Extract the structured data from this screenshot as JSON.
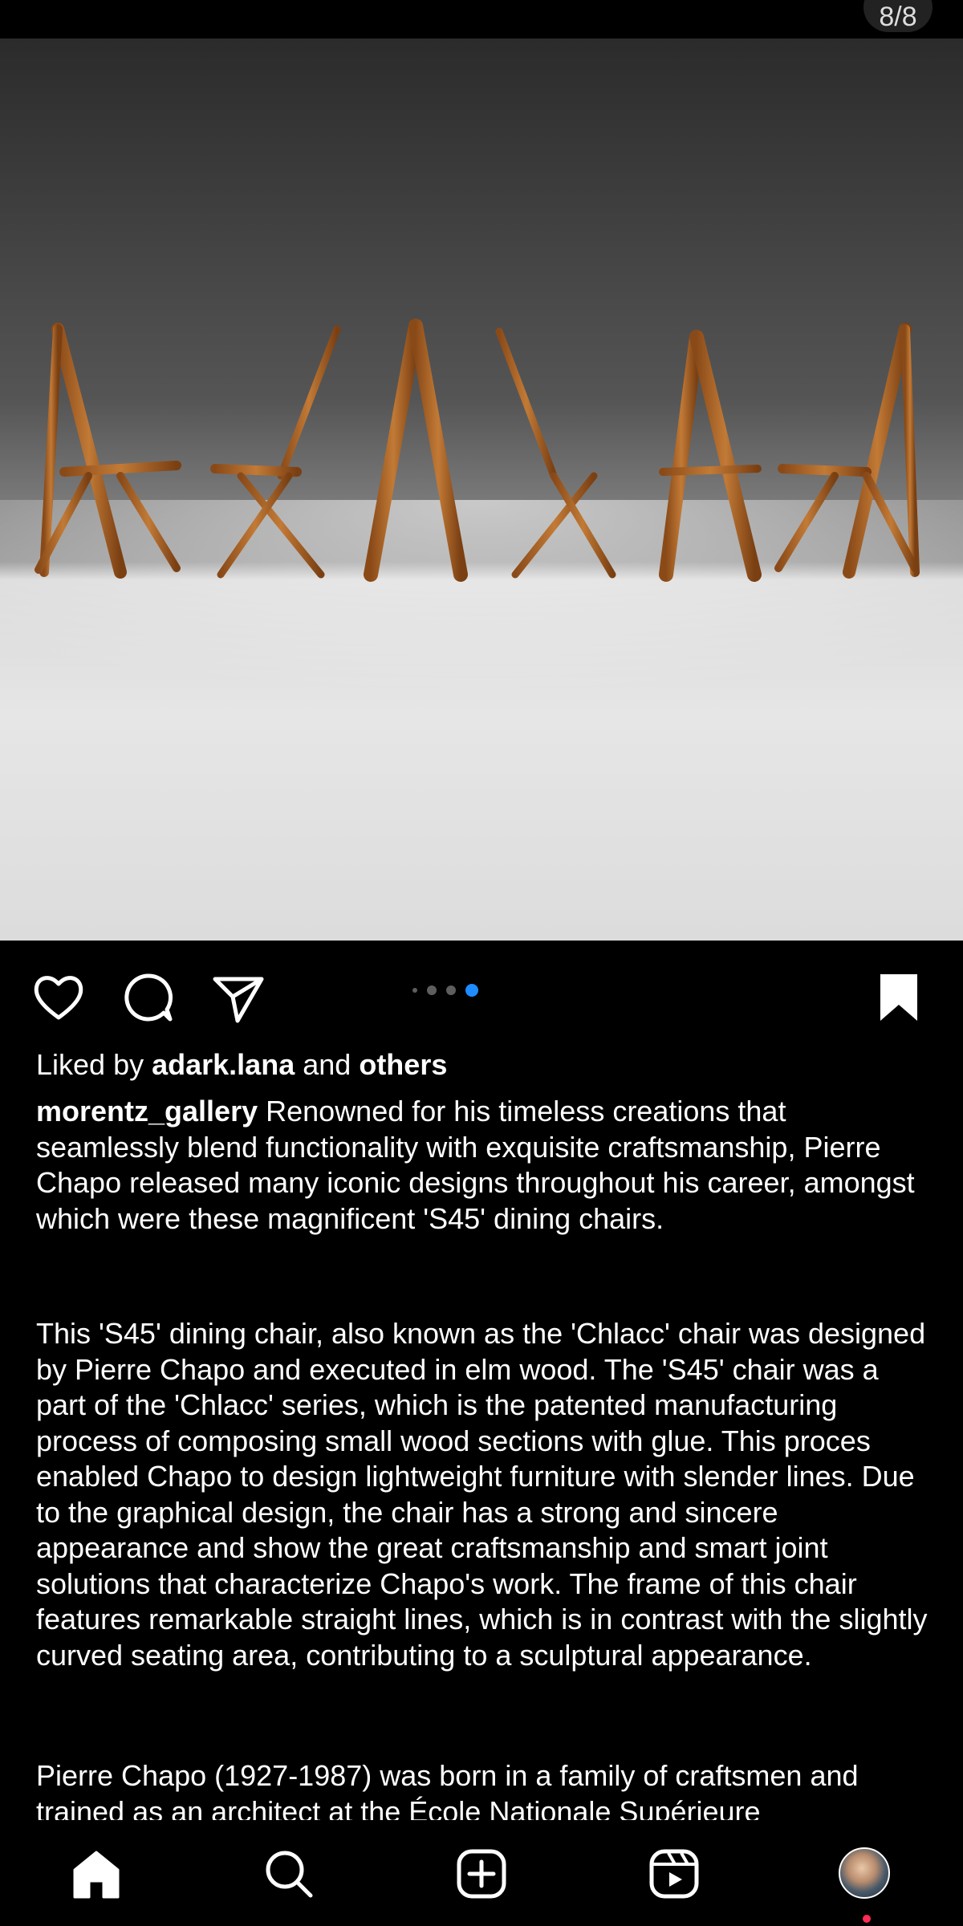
{
  "carousel": {
    "counter": "8/8",
    "total_dots": 4
  },
  "actions": {
    "like_icon": "heart-icon",
    "comment_icon": "comment-icon",
    "share_icon": "paper-plane-icon",
    "save_icon": "bookmark-icon"
  },
  "likes": {
    "prefix": "Liked by",
    "user": "adark.lana",
    "joiner": "and",
    "others": "others"
  },
  "caption": {
    "username": "morentz_gallery",
    "paragraph1": "Renowned for his timeless creations that seamlessly blend functionality with exquisite craftsmanship, Pierre Chapo released many iconic designs throughout his career, amongst which were these magnificent 'S45' dining chairs.",
    "paragraph2": "This 'S45' dining chair, also known as the 'Chlacc' chair was designed by Pierre Chapo and executed in elm wood. The 'S45' chair was a part of the 'Chlacc' series, which is the patented manufacturing process of composing small wood sections with glue. This proces enabled Chapo to design lightweight furniture with slender lines. Due to the graphical design, the chair has a strong and sincere appearance and show the great craftsmanship and smart joint solutions that characterize Chapo's work. The frame of this chair features remarkable straight lines, which is in contrast with the slightly curved seating area, contributing to a sculptural appearance.",
    "paragraph3": "Pierre Chapo (1927-1987) was born in a family of craftsmen and trained as an architect at the École Nationale Supérieure"
  },
  "nav": {
    "items": [
      "home-icon",
      "search-icon",
      "create-post-icon",
      "reels-icon",
      "profile-avatar"
    ]
  },
  "colors": {
    "accent_dot": "#1e8cff",
    "notification": "#ff2d55",
    "wood": "#b5651d"
  }
}
